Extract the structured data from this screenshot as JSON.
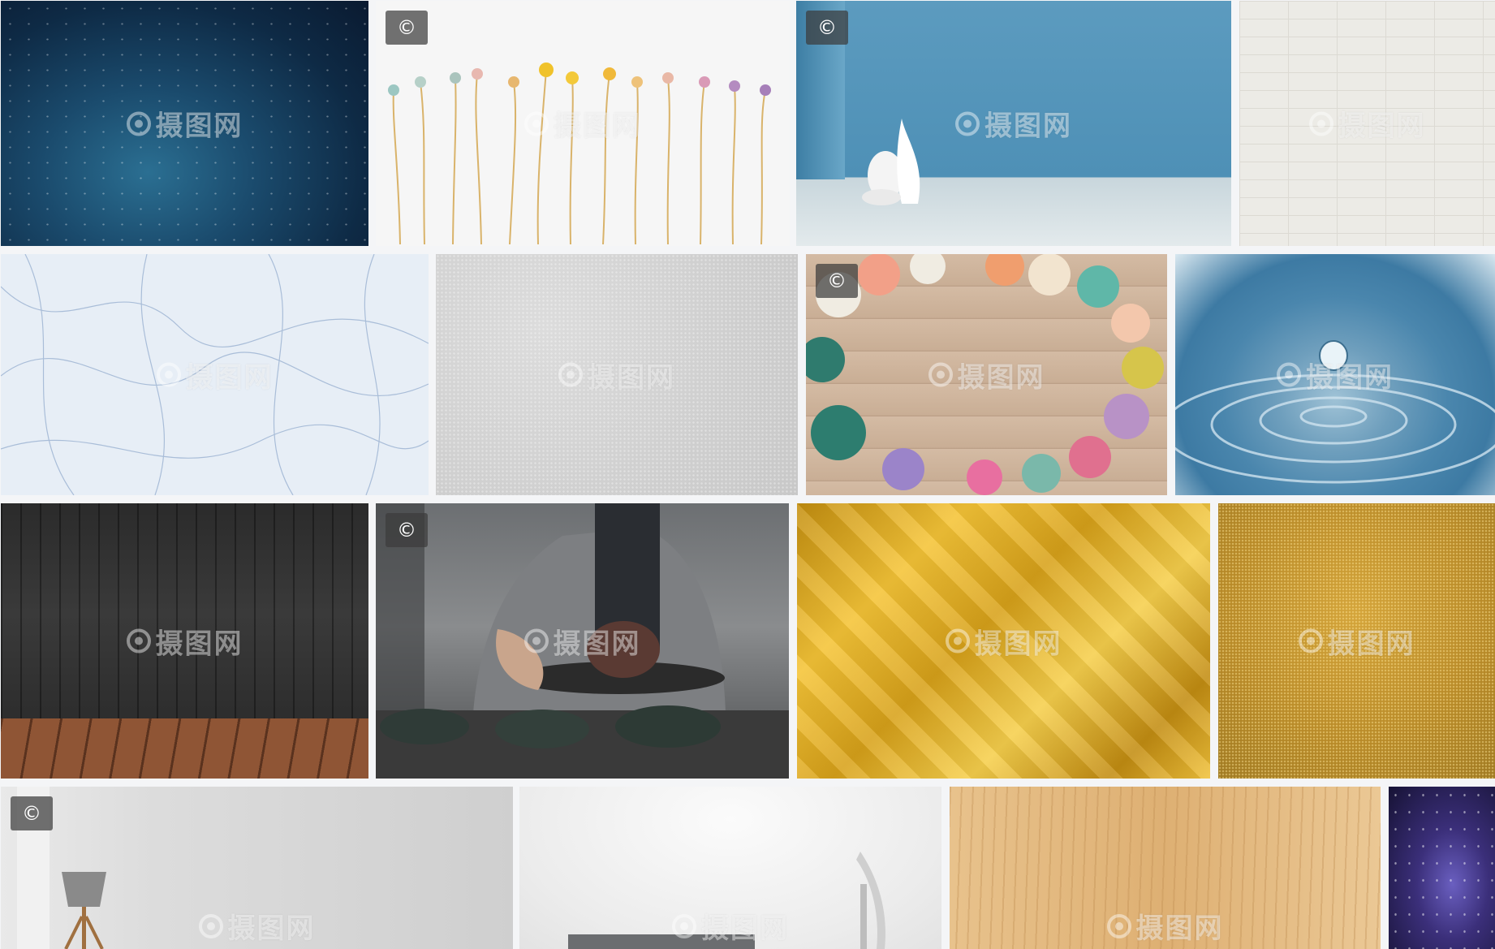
{
  "watermark_text": "摄图网",
  "copyright_symbol": "©",
  "gallery": {
    "tiles": [
      {
        "name": "tile-starry-sky",
        "theme": "starry-sky",
        "copyright": false
      },
      {
        "name": "tile-dried-flowers",
        "theme": "dried-flowers",
        "copyright": true
      },
      {
        "name": "tile-blue-room-vases",
        "theme": "blue-room-vases",
        "copyright": true
      },
      {
        "name": "tile-white-brick-wall",
        "theme": "white-brick-wall",
        "copyright": false
      },
      {
        "name": "tile-blue-line-texture",
        "theme": "blue-line-texture",
        "copyright": false
      },
      {
        "name": "tile-gray-plaster",
        "theme": "gray-plaster",
        "copyright": false
      },
      {
        "name": "tile-flowers-on-wood",
        "theme": "flowers-on-wood",
        "copyright": true
      },
      {
        "name": "tile-water-drop",
        "theme": "water-drop",
        "copyright": false
      },
      {
        "name": "tile-dark-wood-room",
        "theme": "dark-wood-room",
        "copyright": false
      },
      {
        "name": "tile-tea-ceremony",
        "theme": "tea-ceremony",
        "copyright": true
      },
      {
        "name": "tile-gold-foil",
        "theme": "gold-foil",
        "copyright": false
      },
      {
        "name": "tile-gold-glitter",
        "theme": "gold-glitter",
        "copyright": false
      },
      {
        "name": "tile-gray-room-lamp",
        "theme": "gray-room-lamp",
        "copyright": true
      },
      {
        "name": "tile-white-room-sofa",
        "theme": "white-room-sofa",
        "copyright": false
      },
      {
        "name": "tile-light-wood-grain",
        "theme": "light-wood-grain",
        "copyright": false
      },
      {
        "name": "tile-purple-galaxy",
        "theme": "purple-galaxy",
        "copyright": false
      }
    ]
  }
}
